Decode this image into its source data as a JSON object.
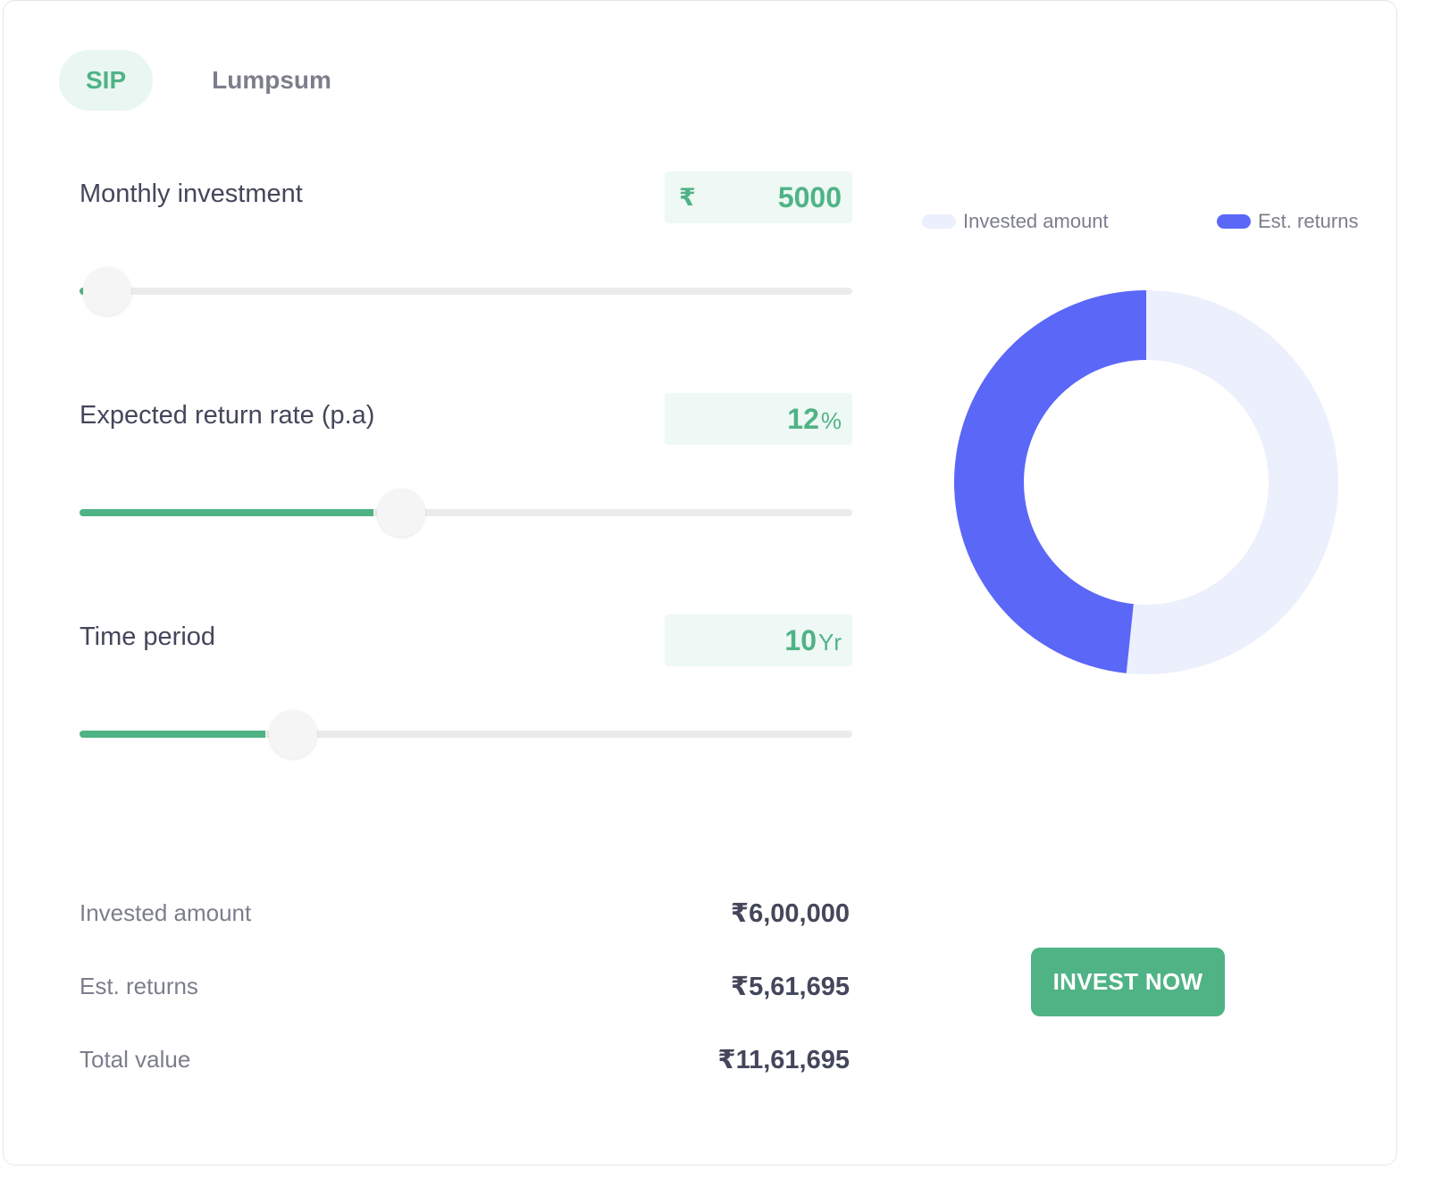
{
  "tabs": [
    {
      "label": "SIP",
      "active": true
    },
    {
      "label": "Lumpsum",
      "active": false
    }
  ],
  "inputs": {
    "monthly": {
      "label": "Monthly investment",
      "prefix": "₹",
      "value": "5000",
      "slider_fraction": 0.0
    },
    "rate": {
      "label": "Expected return rate (p.a)",
      "value": "12",
      "unit": "%",
      "slider_fraction": 0.38
    },
    "period": {
      "label": "Time period",
      "value": "10",
      "unit": "Yr",
      "slider_fraction": 0.24
    }
  },
  "summary": {
    "invested": {
      "label": "Invested amount",
      "value": "₹6,00,000"
    },
    "returns": {
      "label": "Est. returns",
      "value": "₹5,61,695"
    },
    "total": {
      "label": "Total value",
      "value": "₹11,61,695"
    }
  },
  "chart_data": {
    "type": "pie",
    "donut": true,
    "slices": [
      {
        "label": "Invested amount",
        "value": 600000,
        "color": "#eceffc"
      },
      {
        "label": "Est. returns",
        "value": 561695,
        "color": "#5b67f7"
      }
    ],
    "legend_position": "top"
  },
  "cta": {
    "label": "INVEST NOW"
  },
  "colors": {
    "accent": "#4fb386",
    "accent_light": "#eef8f4",
    "invested": "#eceffc",
    "returns": "#5b67f7"
  }
}
